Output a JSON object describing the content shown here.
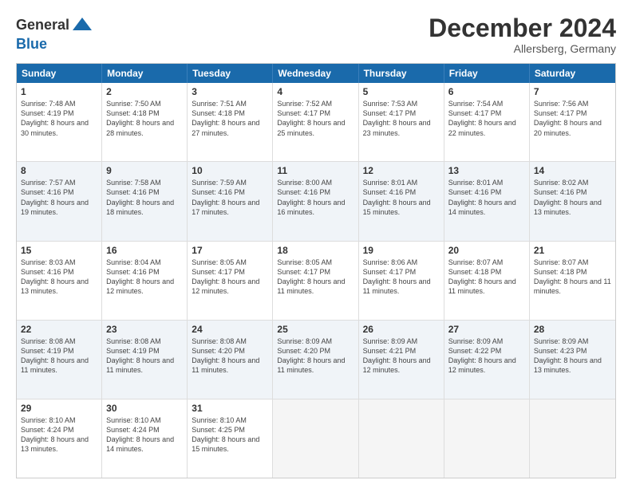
{
  "header": {
    "logo_line1": "General",
    "logo_line2": "Blue",
    "month_title": "December 2024",
    "location": "Allersberg, Germany"
  },
  "days_of_week": [
    "Sunday",
    "Monday",
    "Tuesday",
    "Wednesday",
    "Thursday",
    "Friday",
    "Saturday"
  ],
  "weeks": [
    [
      {
        "day": "1",
        "sunrise": "7:48 AM",
        "sunset": "4:19 PM",
        "daylight": "8 hours and 30 minutes."
      },
      {
        "day": "2",
        "sunrise": "7:50 AM",
        "sunset": "4:18 PM",
        "daylight": "8 hours and 28 minutes."
      },
      {
        "day": "3",
        "sunrise": "7:51 AM",
        "sunset": "4:18 PM",
        "daylight": "8 hours and 27 minutes."
      },
      {
        "day": "4",
        "sunrise": "7:52 AM",
        "sunset": "4:17 PM",
        "daylight": "8 hours and 25 minutes."
      },
      {
        "day": "5",
        "sunrise": "7:53 AM",
        "sunset": "4:17 PM",
        "daylight": "8 hours and 23 minutes."
      },
      {
        "day": "6",
        "sunrise": "7:54 AM",
        "sunset": "4:17 PM",
        "daylight": "8 hours and 22 minutes."
      },
      {
        "day": "7",
        "sunrise": "7:56 AM",
        "sunset": "4:17 PM",
        "daylight": "8 hours and 20 minutes."
      }
    ],
    [
      {
        "day": "8",
        "sunrise": "7:57 AM",
        "sunset": "4:16 PM",
        "daylight": "8 hours and 19 minutes."
      },
      {
        "day": "9",
        "sunrise": "7:58 AM",
        "sunset": "4:16 PM",
        "daylight": "8 hours and 18 minutes."
      },
      {
        "day": "10",
        "sunrise": "7:59 AM",
        "sunset": "4:16 PM",
        "daylight": "8 hours and 17 minutes."
      },
      {
        "day": "11",
        "sunrise": "8:00 AM",
        "sunset": "4:16 PM",
        "daylight": "8 hours and 16 minutes."
      },
      {
        "day": "12",
        "sunrise": "8:01 AM",
        "sunset": "4:16 PM",
        "daylight": "8 hours and 15 minutes."
      },
      {
        "day": "13",
        "sunrise": "8:01 AM",
        "sunset": "4:16 PM",
        "daylight": "8 hours and 14 minutes."
      },
      {
        "day": "14",
        "sunrise": "8:02 AM",
        "sunset": "4:16 PM",
        "daylight": "8 hours and 13 minutes."
      }
    ],
    [
      {
        "day": "15",
        "sunrise": "8:03 AM",
        "sunset": "4:16 PM",
        "daylight": "8 hours and 13 minutes."
      },
      {
        "day": "16",
        "sunrise": "8:04 AM",
        "sunset": "4:16 PM",
        "daylight": "8 hours and 12 minutes."
      },
      {
        "day": "17",
        "sunrise": "8:05 AM",
        "sunset": "4:17 PM",
        "daylight": "8 hours and 12 minutes."
      },
      {
        "day": "18",
        "sunrise": "8:05 AM",
        "sunset": "4:17 PM",
        "daylight": "8 hours and 11 minutes."
      },
      {
        "day": "19",
        "sunrise": "8:06 AM",
        "sunset": "4:17 PM",
        "daylight": "8 hours and 11 minutes."
      },
      {
        "day": "20",
        "sunrise": "8:07 AM",
        "sunset": "4:18 PM",
        "daylight": "8 hours and 11 minutes."
      },
      {
        "day": "21",
        "sunrise": "8:07 AM",
        "sunset": "4:18 PM",
        "daylight": "8 hours and 11 minutes."
      }
    ],
    [
      {
        "day": "22",
        "sunrise": "8:08 AM",
        "sunset": "4:19 PM",
        "daylight": "8 hours and 11 minutes."
      },
      {
        "day": "23",
        "sunrise": "8:08 AM",
        "sunset": "4:19 PM",
        "daylight": "8 hours and 11 minutes."
      },
      {
        "day": "24",
        "sunrise": "8:08 AM",
        "sunset": "4:20 PM",
        "daylight": "8 hours and 11 minutes."
      },
      {
        "day": "25",
        "sunrise": "8:09 AM",
        "sunset": "4:20 PM",
        "daylight": "8 hours and 11 minutes."
      },
      {
        "day": "26",
        "sunrise": "8:09 AM",
        "sunset": "4:21 PM",
        "daylight": "8 hours and 12 minutes."
      },
      {
        "day": "27",
        "sunrise": "8:09 AM",
        "sunset": "4:22 PM",
        "daylight": "8 hours and 12 minutes."
      },
      {
        "day": "28",
        "sunrise": "8:09 AM",
        "sunset": "4:23 PM",
        "daylight": "8 hours and 13 minutes."
      }
    ],
    [
      {
        "day": "29",
        "sunrise": "8:10 AM",
        "sunset": "4:24 PM",
        "daylight": "8 hours and 13 minutes."
      },
      {
        "day": "30",
        "sunrise": "8:10 AM",
        "sunset": "4:24 PM",
        "daylight": "8 hours and 14 minutes."
      },
      {
        "day": "31",
        "sunrise": "8:10 AM",
        "sunset": "4:25 PM",
        "daylight": "8 hours and 15 minutes."
      },
      null,
      null,
      null,
      null
    ]
  ]
}
